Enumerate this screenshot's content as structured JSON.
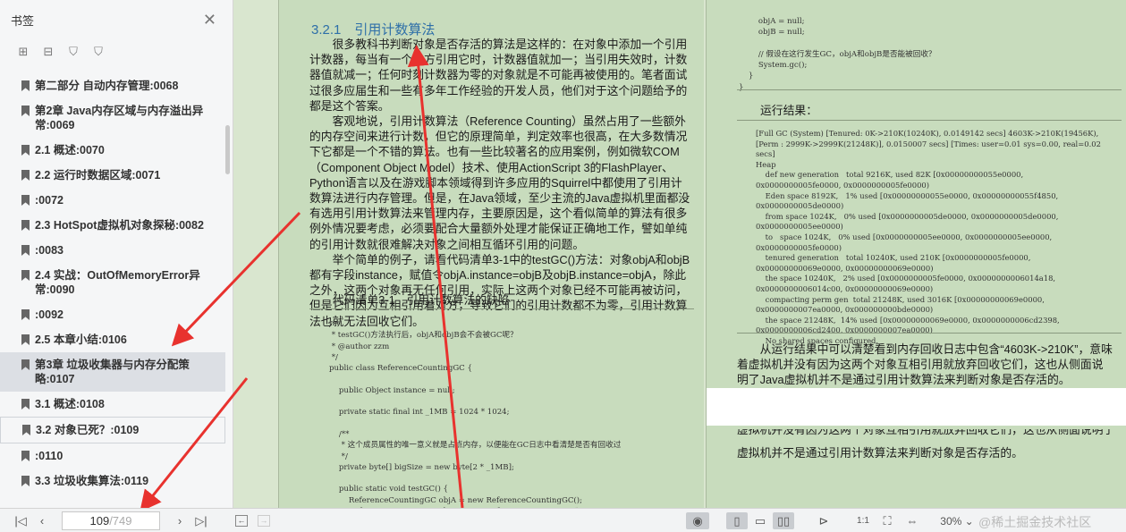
{
  "sidebar": {
    "title": "书签",
    "items": [
      {
        "label": "第二部分 自动内存管理:0068"
      },
      {
        "label": "第2章 Java内存区域与内存溢出异常:0069"
      },
      {
        "label": "2.1 概述:0070"
      },
      {
        "label": "2.2 运行时数据区域:0071"
      },
      {
        "label": ":0072"
      },
      {
        "label": "2.3 HotSpot虚拟机对象探秘:0082"
      },
      {
        "label": ":0083"
      },
      {
        "label": "2.4 实战：OutOfMemoryError异常:0090"
      },
      {
        "label": ":0092"
      },
      {
        "label": "2.5 本章小结:0106"
      },
      {
        "label": "第3章 垃圾收集器与内存分配策略:0107"
      },
      {
        "label": "3.1 概述:0108"
      },
      {
        "label": "3.2 对象已死？:0109"
      },
      {
        "label": ":0110"
      },
      {
        "label": "3.3 垃圾收集算法:0119"
      }
    ]
  },
  "left_page": {
    "heading": "3.2.1　引用计数算法",
    "p1": "很多教科书判断对象是否存活的算法是这样的：在对象中添加一个引用计数器，每当有一个地方引用它时，计数器值就加一；当引用失效时，计数器值就减一；任何时刻计数器为零的对象就是不可能再被使用的。笔者面试过很多应届生和一些有多年工作经验的开发人员，他们对于这个问题给予的都是这个答案。",
    "p2": "客观地说，引用计数算法（Reference Counting）虽然占用了一些额外的内存空间来进行计数，但它的原理简单，判定效率也很高，在大多数情况下它都是一个不错的算法。也有一些比较著名的应用案例，例如微软COM（Component Object Model）技术、使用ActionScript 3的FlashPlayer、Python语言以及在游戏脚本领域得到许多应用的Squirrel中都使用了引用计数算法进行内存管理。但是，在Java领域，至少主流的Java虚拟机里面都没有选用引用计数算法来管理内存，主要原因是，这个看似简单的算法有很多例外情况要考虑，必须要配合大量额外处理才能保证正确地工作，譬如单纯的引用计数就很难解决对象之间相互循环引用的问题。",
    "p3": "举个简单的例子，请看代码清单3-1中的testGC()方法：对象objA和objB都有字段instance，赋值令objA.instance=objB及objB.instance=objA，除此之外，这两个对象再无任何引用，实际上这两个对象已经不可能再被访问，但是它们因为互相引用着对方，导致它们的引用计数都不为零，引用计数算法也就无法回收它们。",
    "listing_title": "代码清单3-1　引用计数算法的缺陷",
    "code": "/**\n * testGC()方法执行后，objA和objB会不会被GC呢？\n * @author zzm\n */\npublic class ReferenceCountingGC {\n\n    public Object instance = null;\n\n    private static final int _1MB = 1024 * 1024;\n\n    /**\n     * 这个成员属性的唯一意义就是占点内存，以便能在GC日志中看清楚是否有回收过\n     */\n    private byte[] bigSize = new byte[2 * _1MB];\n\n    public static void testGC() {\n        ReferenceCountingGC objA = new ReferenceCountingGC();\n        ReferenceCountingGC objB = new ReferenceCountingGC();\n        objA.instance = objB;\n        objB.instance = objA;"
  },
  "right_page": {
    "code_top": "        objA = null;\n        objB = null;\n\n        // 假设在这行发生GC，objA和objB是否能被回收？\n        System.gc();\n    }\n}",
    "result_title": "运行结果：",
    "log": "[Full GC (System) [Tenured: 0K->210K(10240K), 0.0149142 secs] 4603K->210K(19456K),\n[Perm : 2999K->2999K(21248K)], 0.0150007 secs] [Times: user=0.01 sys=0.00, real=0.02\nsecs]\nHeap\n    def new generation   total 9216K, used 82K [0x00000000055e0000,\n0x0000000005fe0000, 0x0000000005fe0000)\n    Eden space 8192K,   1% used [0x00000000055e0000, 0x00000000055f4850,\n0x0000000005de0000)\n    from space 1024K,   0% used [0x0000000005de0000, 0x0000000005de0000,\n0x0000000005ee0000)\n    to   space 1024K,   0% used [0x0000000005ee0000, 0x0000000005ee0000,\n0x0000000005fe0000)\n    tenured generation   total 10240K, used 210K [0x0000000005fe0000,\n0x00000000069e0000, 0x00000000069e0000)\n    the space 10240K,   2% used [0x0000000005fe0000, 0x0000000006014a18,\n0x0000000006014c00, 0x00000000069e0000)\n    compacting perm gen  total 21248K, used 3016K [0x00000000069e0000,\n0x0000000007ea0000, 0x000000000bde0000)\n    the space 21248K,  14% used [0x00000000069e0000, 0x0000000006cd2398,\n0x0000000006cd2400, 0x0000000007ea0000)\n    No shared spaces configured.",
    "conclusion": "从运行结果中可以清楚看到内存回收日志中包含“4603K->210K”，意味着虚拟机并没有因为这两个对象互相引用就放弃回收它们，这也从侧面说明了Java虚拟机并不是通过引用计数算法来判断对象是否存活的。",
    "ghost_line1": "虚拟机并没有因为这两个对象互相引用就放弃回收它们，这也从侧面说明了Java",
    "ghost_line2": "虚拟机并不是通过引用计数算法来判断对象是否存活的。"
  },
  "toolbar": {
    "current_page": "109",
    "total_pages": "/749",
    "zoom": "30%",
    "watermark": "@稀土掘金技术社区"
  },
  "colors": {
    "page_bg": "#c8dcbd",
    "heading": "#2e6fa8",
    "arrow": "#e8322e"
  }
}
